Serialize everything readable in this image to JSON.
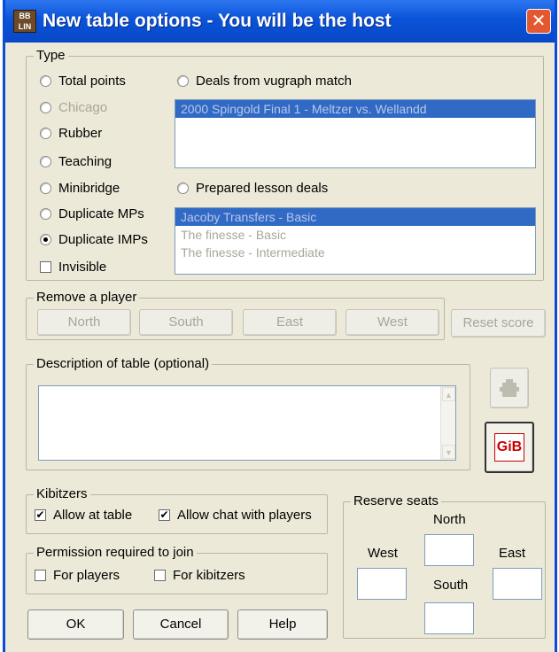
{
  "window": {
    "title": "New table options - You will be the host",
    "app_icon_text": "BB\nLIN",
    "close_glyph": "✕"
  },
  "type_group": {
    "legend": "Type",
    "options": [
      {
        "label": "Total points",
        "checked": false,
        "disabled": false
      },
      {
        "label": "Chicago",
        "checked": false,
        "disabled": true
      },
      {
        "label": "Rubber",
        "checked": false,
        "disabled": false
      },
      {
        "label": "Teaching",
        "checked": false,
        "disabled": false
      },
      {
        "label": "Minibridge",
        "checked": false,
        "disabled": false
      },
      {
        "label": "Duplicate MPs",
        "checked": false,
        "disabled": false
      },
      {
        "label": "Duplicate IMPs",
        "checked": true,
        "disabled": false
      }
    ],
    "invisible_label": "Invisible",
    "invisible_checked": false,
    "vugraph_label": "Deals from vugraph match",
    "vugraph_items": [
      "2000 Spingold Final 1 - Meltzer vs. Wellandd"
    ],
    "lesson_label": "Prepared lesson deals",
    "lesson_items": [
      "Jacoby Transfers - Basic",
      "The finesse - Basic",
      "The finesse - Intermediate"
    ]
  },
  "remove_player": {
    "legend": "Remove a player",
    "north": "North",
    "south": "South",
    "east": "East",
    "west": "West"
  },
  "reset_score_label": "Reset score",
  "description": {
    "legend": "Description of table (optional)",
    "value": ""
  },
  "gib_label": "GiB",
  "kibitzers": {
    "legend": "Kibitzers",
    "allow_at_table": "Allow at table",
    "allow_chat": "Allow chat with players"
  },
  "permission": {
    "legend": "Permission required to join",
    "for_players": "For players",
    "for_kibitzers": "For kibitzers"
  },
  "reserve": {
    "legend": "Reserve seats",
    "north": "North",
    "west": "West",
    "east": "East",
    "south": "South"
  },
  "buttons": {
    "ok": "OK",
    "cancel": "Cancel",
    "help": "Help"
  }
}
